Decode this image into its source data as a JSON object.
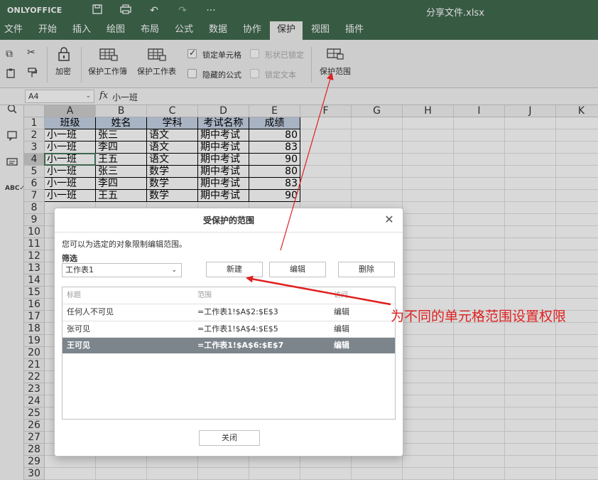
{
  "app": {
    "logo": "ONLYOFFICE",
    "doc_title": "分享文件.xlsx"
  },
  "menu": [
    "文件",
    "开始",
    "插入",
    "绘图",
    "布局",
    "公式",
    "数据",
    "协作",
    "保护",
    "视图",
    "插件"
  ],
  "menu_active": "保护",
  "toolbar": {
    "encrypt": "加密",
    "protect_workbook": "保护工作簿",
    "protect_sheet": "保护工作表",
    "lock_cell": "锁定单元格",
    "shape_locked": "形状已锁定",
    "hidden_formula": "隐藏的公式",
    "lock_text": "锁定文本",
    "protect_range": "保护范围"
  },
  "formula_bar": {
    "cell_ref": "A4",
    "fx": "fx",
    "value": "小一班"
  },
  "columns": [
    "A",
    "B",
    "C",
    "D",
    "E",
    "F",
    "G",
    "H",
    "I",
    "J",
    "K"
  ],
  "rows": [
    "1",
    "2",
    "3",
    "4",
    "5",
    "6",
    "7",
    "8",
    "9",
    "10",
    "11",
    "12",
    "13",
    "14",
    "15",
    "16",
    "17",
    "18",
    "19",
    "20",
    "21",
    "22",
    "23",
    "24",
    "25",
    "26",
    "27",
    "28",
    "29",
    "30"
  ],
  "sheet": {
    "header": [
      "班级",
      "姓名",
      "学科",
      "考试名称",
      "成绩"
    ],
    "data": [
      [
        "小一班",
        "张三",
        "语文",
        "期中考试",
        "80"
      ],
      [
        "小一班",
        "李四",
        "语文",
        "期中考试",
        "83"
      ],
      [
        "小一班",
        "王五",
        "语文",
        "期中考试",
        "90"
      ],
      [
        "小一班",
        "张三",
        "数学",
        "期中考试",
        "80"
      ],
      [
        "小一班",
        "李四",
        "数学",
        "期中考试",
        "83"
      ],
      [
        "小一班",
        "王五",
        "数学",
        "期中考试",
        "90"
      ]
    ]
  },
  "dialog": {
    "title": "受保护的范围",
    "description": "您可以为选定的对象限制编辑范围。",
    "filter_label": "筛选",
    "filter_value": "工作表1",
    "btn_new": "新建",
    "btn_edit": "编辑",
    "btn_delete": "删除",
    "col_title": "标题",
    "col_range": "范围",
    "col_access": "访问",
    "ranges": [
      {
        "title": "任何人不可见",
        "range": "=工作表1!$A$2:$E$3",
        "access": "编辑"
      },
      {
        "title": "张可见",
        "range": "=工作表1!$A$4:$E$5",
        "access": "编辑"
      },
      {
        "title": "王可见",
        "range": "=工作表1!$A$6:$E$7",
        "access": "编辑"
      }
    ],
    "btn_close": "关闭"
  },
  "annotation": "为不同的单元格范围设置权限",
  "colors": {
    "brand": "#416a4f",
    "header_fill": "#c6d3e6",
    "selected_row": "#7d858c",
    "annotation": "#e02020"
  }
}
